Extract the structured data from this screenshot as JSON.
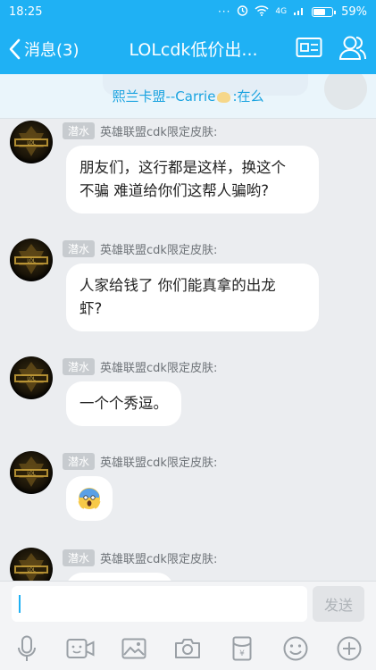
{
  "status_bar": {
    "time": "18:25",
    "dots": "···",
    "network": "4G",
    "battery": "59%",
    "battery_level": 0.59
  },
  "nav": {
    "back_label": "消息(3)",
    "title": "LOLcdk低价出..."
  },
  "announcement": {
    "prefix": "熙兰卡盟--Carrie",
    "suffix": ":在么"
  },
  "messages": [
    {
      "badge": "潜水",
      "sender": "英雄联盟cdk限定皮肤:",
      "line1": "朋友们，这行都是这样，换这个",
      "line2": "不骗 难道给你们这帮人骗哟?"
    },
    {
      "badge": "潜水",
      "sender": "英雄联盟cdk限定皮肤:",
      "line1": "人家给钱了 你们能真拿的出龙",
      "line2": "虾?"
    },
    {
      "badge": "潜水",
      "sender": "英雄联盟cdk限定皮肤:",
      "line1": "一个个秀逗。"
    },
    {
      "badge": "潜水",
      "sender": "英雄联盟cdk限定皮肤:",
      "emoji": "scream-emoji"
    },
    {
      "badge": "潜水",
      "sender": "英雄联盟cdk限定皮肤:"
    }
  ],
  "input": {
    "value": "",
    "send_label": "发送"
  },
  "toolbar": [
    "microphone-icon",
    "video-icon",
    "image-icon",
    "camera-icon",
    "red-packet-icon",
    "emoji-icon",
    "plus-icon"
  ],
  "colors": {
    "accent": "#1fb1f4",
    "background": "#ebedf0",
    "announce_text": "#1aa3e0"
  }
}
